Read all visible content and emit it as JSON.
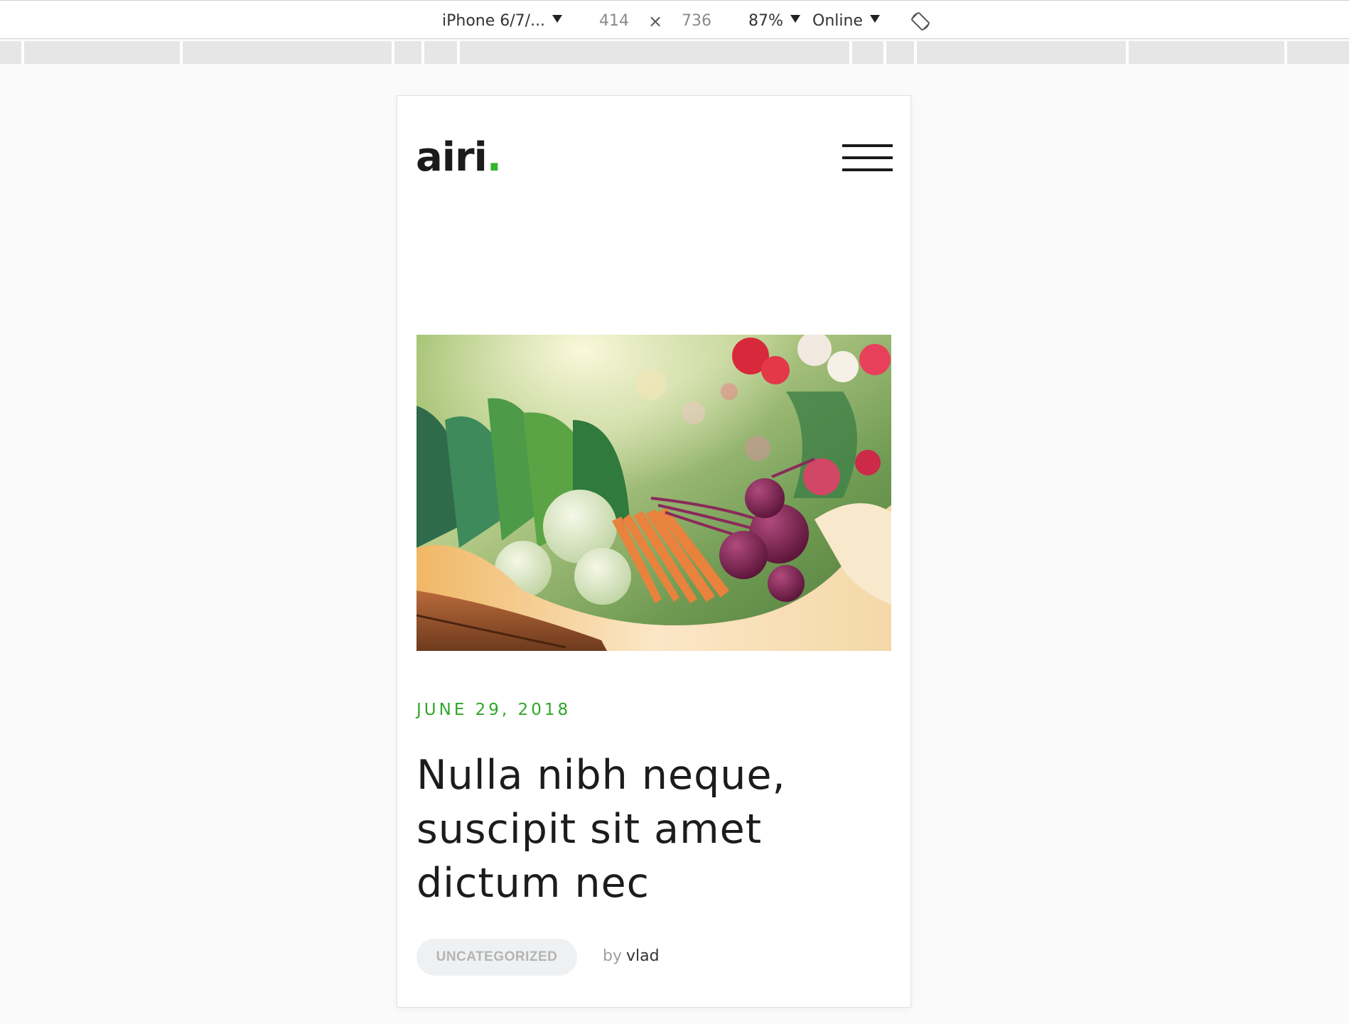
{
  "device_toolbar": {
    "device": "iPhone 6/7/...",
    "width": "414",
    "times": "×",
    "height": "736",
    "zoom": "87%",
    "network": "Online"
  },
  "site": {
    "logo_text": "airi",
    "logo_dot": ".",
    "accent_color": "#2fb62a"
  },
  "post": {
    "date": "JUNE 29, 2018",
    "title": "Nulla nibh neque, suscipit sit amet dictum nec",
    "category": "UNCATEGORIZED",
    "by_label": "by",
    "author": "vlad"
  },
  "icons": {
    "menu": "hamburger-icon",
    "rotate": "rotate-device-icon"
  }
}
